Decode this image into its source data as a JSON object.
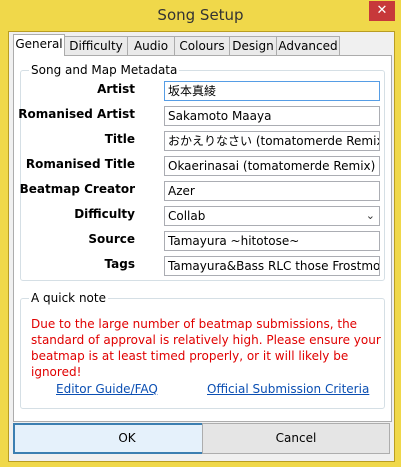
{
  "window": {
    "title": "Song Setup",
    "close_glyph": "✕"
  },
  "tabs": [
    "General",
    "Difficulty",
    "Audio",
    "Colours",
    "Design",
    "Advanced"
  ],
  "metadata": {
    "group_label": "Song and Map Metadata",
    "fields": [
      {
        "label": "Artist",
        "value": "坂本真綾"
      },
      {
        "label": "Romanised Artist",
        "value": "Sakamoto Maaya"
      },
      {
        "label": "Title",
        "value": "おかえりなさい (tomatomerde Remix)"
      },
      {
        "label": "Romanised Title",
        "value": "Okaerinasai (tomatomerde Remix)"
      },
      {
        "label": "Beatmap Creator",
        "value": "Azer"
      },
      {
        "label": "Difficulty",
        "value": "Collab"
      },
      {
        "label": "Source",
        "value": "Tamayura ~hitotose~"
      },
      {
        "label": "Tags",
        "value": "Tamayura&Bass RLC those Frostmourne"
      }
    ]
  },
  "note": {
    "group_label": "A quick note",
    "text": "Due to the large number of beatmap submissions, the standard of approval is relatively high.  Please ensure your beatmap is at least timed properly, or it will likely be ignored!",
    "link_editor": "Editor Guide/FAQ",
    "link_criteria": "Official Submission Criteria"
  },
  "buttons": {
    "ok": "OK",
    "cancel": "Cancel"
  },
  "colors": {
    "frame": "#f0d84a",
    "close": "#c7383a",
    "note_text": "#e00000",
    "link": "#0b4fb3"
  }
}
